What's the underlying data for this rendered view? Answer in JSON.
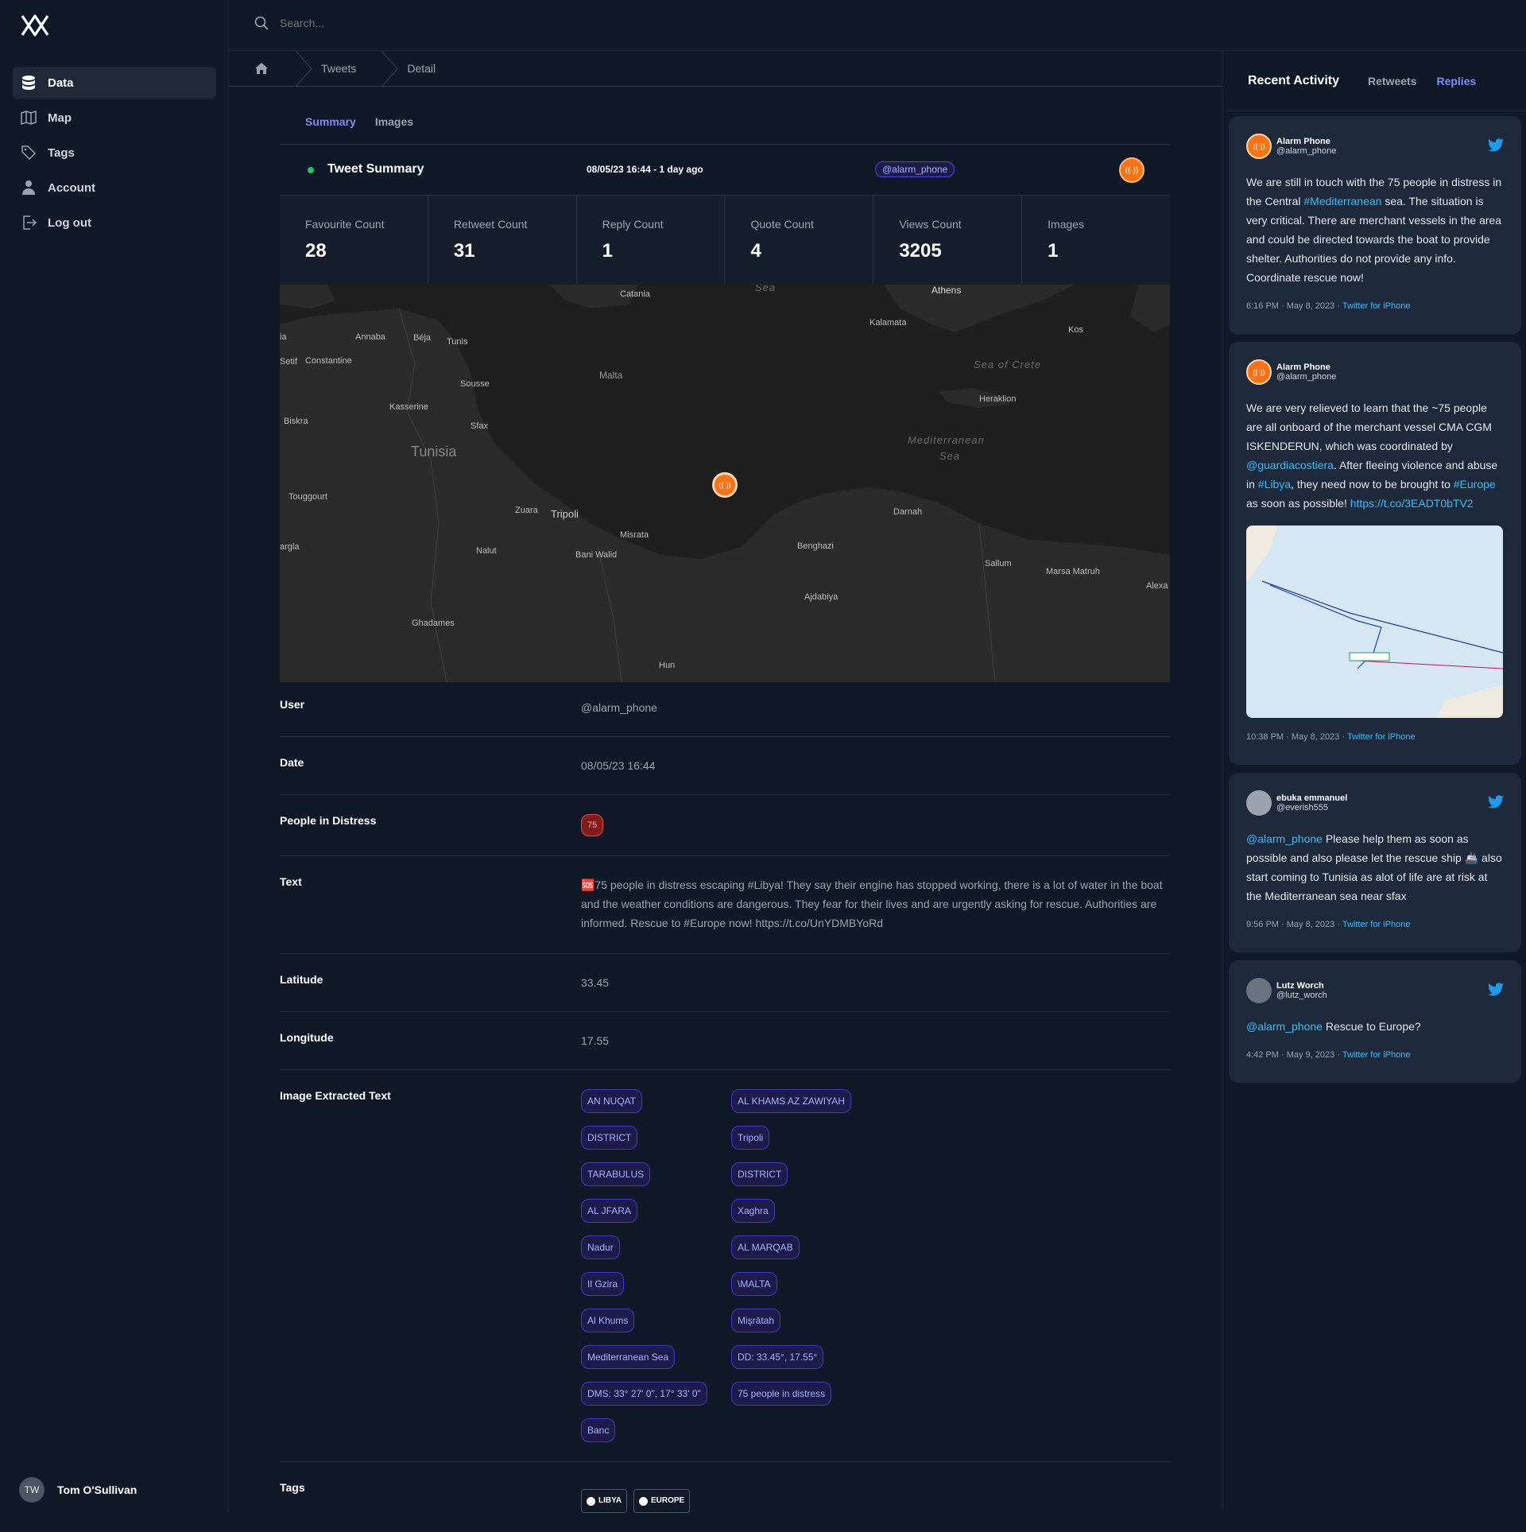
{
  "app": {
    "user_initials": "TW",
    "user_name": "Tom O'Sullivan"
  },
  "sidebar": {
    "items": [
      {
        "label": "Data",
        "icon": "database-icon",
        "active": true
      },
      {
        "label": "Map",
        "icon": "map-icon",
        "active": false
      },
      {
        "label": "Tags",
        "icon": "tag-icon",
        "active": false
      },
      {
        "label": "Account",
        "icon": "user-icon",
        "active": false
      },
      {
        "label": "Log out",
        "icon": "logout-icon",
        "active": false
      }
    ]
  },
  "search": {
    "placeholder": "Search..."
  },
  "breadcrumb": {
    "items": [
      "Tweets",
      "Detail"
    ]
  },
  "tabs": [
    "Summary",
    "Images"
  ],
  "summary": {
    "title": "Tweet Summary",
    "date": "08/05/23 16:44 - 1 day ago",
    "handle": "@alarm_phone",
    "stats": [
      {
        "label": "Favourite Count",
        "value": "28"
      },
      {
        "label": "Retweet Count",
        "value": "31"
      },
      {
        "label": "Reply Count",
        "value": "1"
      },
      {
        "label": "Quote Count",
        "value": "4"
      },
      {
        "label": "Views Count",
        "value": "3205"
      },
      {
        "label": "Images",
        "value": "1"
      }
    ]
  },
  "map": {
    "labels": [
      "Catania",
      "Athens",
      "Sea",
      "Kalamata",
      "Kos",
      "Annaba",
      "Béja",
      "Tunis",
      "ia",
      "Constantine",
      "Setif",
      "Sousse",
      "Malta",
      "Sea of Crete",
      "Heraklion",
      "Kasserine",
      "Biskra",
      "Sfax",
      "Tunisia",
      "Mediterranean",
      "Sea",
      "Touggourt",
      "Zuara",
      "Tripoli",
      "Misrata",
      "Darnah",
      "Benghazi",
      "argla",
      "Nalut",
      "Bani Walid",
      "Sallum",
      "Marsa Matruh",
      "Alexa",
      "Ajdabiya",
      "Ghadames",
      "Hun"
    ]
  },
  "details": {
    "user_label": "User",
    "user_value": "@alarm_phone",
    "date_label": "Date",
    "date_value": "08/05/23 16:44",
    "distress_label": "People in Distress",
    "distress_value": "75",
    "text_label": "Text",
    "text_value": "🆘75 people in distress escaping #Libya! They say their engine has stopped working, there is a lot of water in the boat and the weather conditions are dangerous. They fear for their lives and are urgently asking for rescue. Authorities are informed. Rescue to #Europe now! https://t.co/UnYDMBYoRd",
    "lat_label": "Latitude",
    "lat_value": "33.45",
    "lon_label": "Longitude",
    "lon_value": "17.55",
    "ocr_label": "Image Extracted Text",
    "ocr_chips": [
      "AN NUQAT",
      "AL KHAMS AZ ZAWIYAH",
      "DISTRICT",
      "Tripoli",
      "TARABULUS",
      "DISTRICT",
      "AL JFARA",
      "Xaghra",
      "Nadur",
      "AL MARQAB",
      "Il Gzira",
      "\\MALTA",
      "Al Khums",
      "Mişrātah",
      "Mediterranean Sea",
      "DD: 33.45°, 17.55°",
      "DMS: 33° 27' 0\", 17° 33' 0\"",
      "75 people in distress",
      "Banc"
    ],
    "tags_label": "Tags",
    "tags": [
      "LIBYA",
      "EUROPE"
    ]
  },
  "activity": {
    "title": "Recent Activity",
    "tabs": [
      "Retweets",
      "Replies"
    ],
    "tweets": [
      {
        "name": "Alarm Phone",
        "handle": "@alarm_phone",
        "t1": "We are still in touch with the 75 people in distress in the Central ",
        "l1": "#Mediterranean",
        "t2": " sea. The situation is very critical. There are merchant vessels in the area and could be directed towards the boat to provide shelter. Authorities do not provide any info. Coordinate rescue now!",
        "time": "6:16 PM · May 8, 2023 · ",
        "source": "Twitter for iPhone"
      },
      {
        "name": "Alarm Phone",
        "handle": "@alarm_phone",
        "t1": "We are very relieved to learn that the ~75 people are all onboard of the merchant vessel CMA CGM ISKENDERUN, which was coordinated by ",
        "l1": "@guardiacostiera",
        "t2": ". After fleeing violence and abuse in ",
        "l2": "#Libya",
        "t3": ", they need now to be brought to ",
        "l3": "#Europe",
        "t4": " as soon as possible! ",
        "l4": "https://t.co/3EADT0bTV2",
        "time": "10:38 PM · May 8, 2023 · ",
        "source": "Twitter for iPhone"
      },
      {
        "name": "ebuka emmanuel",
        "handle": "@everish555",
        "l1": "@alarm_phone",
        "t1": " Please help them as soon as possible and also please let the rescue ship 🚢 also start coming to Tunisia as alot of life are at risk at the Mediterranean sea near sfax",
        "time": "9:56 PM · May 8, 2023 · ",
        "source": "Twitter for iPhone"
      },
      {
        "name": "Lutz Worch",
        "handle": "@lutz_worch",
        "l1": "@alarm_phone",
        "t1": " Rescue to Europe?",
        "time": "4:42 PM · May 9, 2023 · ",
        "source": "Twitter for iPhone"
      }
    ]
  }
}
